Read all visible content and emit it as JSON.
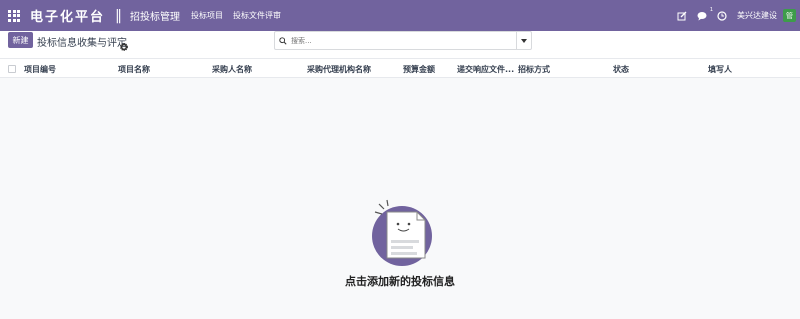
{
  "navbar": {
    "brand": "电子化平台",
    "separator": "‖",
    "app_title": "招投标管理",
    "menu": [
      "投标项目",
      "投标文件评审"
    ],
    "chat_count": "1",
    "company": "美兴达建设",
    "avatar_letter": "管",
    "bg_color": "#71639e"
  },
  "control": {
    "new_label": "新建",
    "breadcrumb": "投标信息收集与评定",
    "search_placeholder": "搜索..."
  },
  "table": {
    "columns": [
      "项目编号",
      "项目名称",
      "采购人名称",
      "采购代理机构名称",
      "预算金额",
      "递交响应文件...",
      "招标方式",
      "状态",
      "填写人"
    ]
  },
  "empty_state": {
    "title": "点击添加新的投标信息"
  },
  "icons": {
    "apps": "apps-grid-icon",
    "edit": "edit-icon",
    "chat": "chat-icon",
    "clock": "clock-icon",
    "gear": "gear-icon",
    "search": "search-icon"
  }
}
